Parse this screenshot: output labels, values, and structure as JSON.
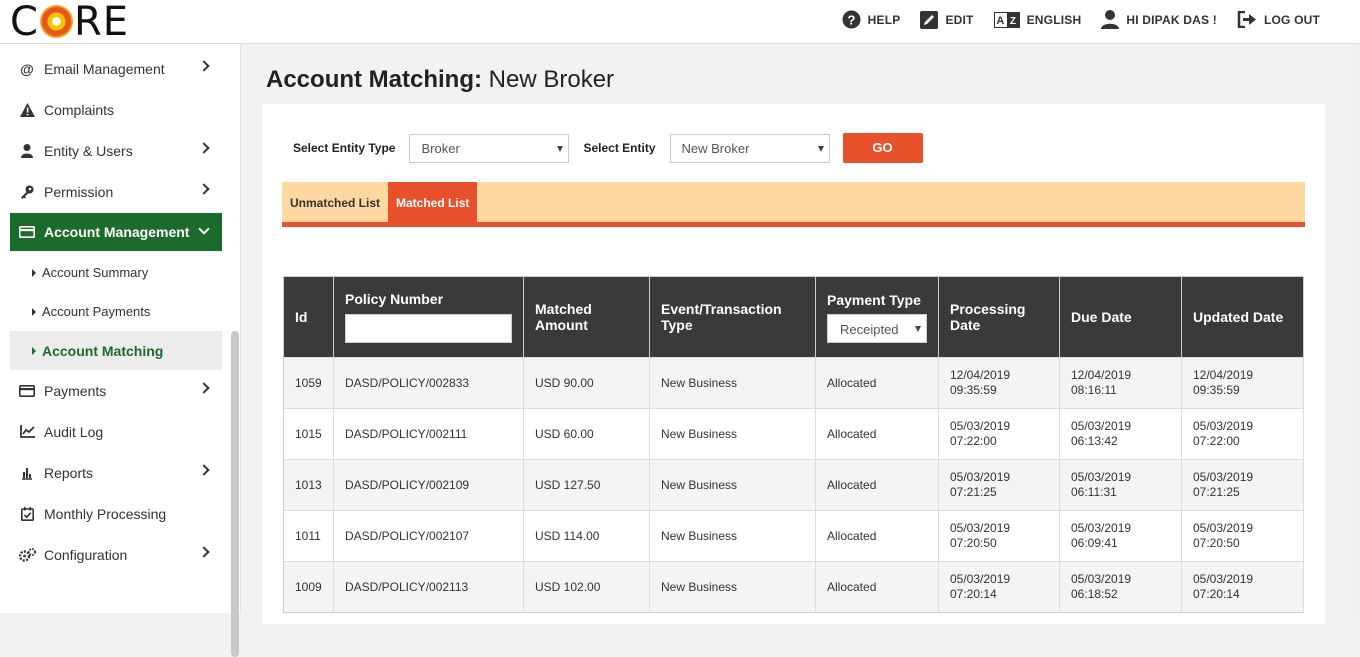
{
  "app": {
    "logo_text_left": "C",
    "logo_text_right": "RE"
  },
  "topnav": {
    "help": "HELP",
    "edit": "EDIT",
    "language": "ENGLISH",
    "user": "HI DIPAK DAS !",
    "logout": "LOG OUT"
  },
  "sidebar": {
    "items": [
      {
        "label": "Email Management",
        "icon": "at-icon",
        "chevron": true
      },
      {
        "label": "Complaints",
        "icon": "warning-icon",
        "chevron": false
      },
      {
        "label": "Entity & Users",
        "icon": "user-icon",
        "chevron": true
      },
      {
        "label": "Permission",
        "icon": "key-icon",
        "chevron": true
      },
      {
        "label": "Account Management",
        "icon": "card-icon",
        "chevron": true,
        "active": true
      },
      {
        "label": "Payments",
        "icon": "card-icon",
        "chevron": true
      },
      {
        "label": "Audit Log",
        "icon": "chart-icon",
        "chevron": false
      },
      {
        "label": "Reports",
        "icon": "reports-icon",
        "chevron": true
      },
      {
        "label": "Monthly Processing",
        "icon": "calendar-check-icon",
        "chevron": false
      },
      {
        "label": "Configuration",
        "icon": "gears-icon",
        "chevron": true
      }
    ],
    "subitems": [
      {
        "label": "Account Summary"
      },
      {
        "label": "Account Payments"
      },
      {
        "label": "Account Matching",
        "active": true
      }
    ]
  },
  "page": {
    "title_bold": "Account Matching:",
    "title_rest": "New Broker"
  },
  "filters": {
    "entity_type_label": "Select Entity Type",
    "entity_type_value": "Broker",
    "entity_label": "Select Entity",
    "entity_value": "New Broker",
    "go_label": "GO"
  },
  "tabs": [
    {
      "label": "Unmatched List",
      "active": false
    },
    {
      "label": "Matched List",
      "active": true
    }
  ],
  "table": {
    "headers": {
      "id": "Id",
      "policy": "Policy Number",
      "matched": "Matched Amount",
      "event": "Event/Transaction Type",
      "payment": "Payment Type",
      "processing": "Processing Date",
      "due": "Due Date",
      "updated": "Updated Date"
    },
    "payment_filter_value": "Receipted",
    "rows": [
      {
        "id": "1059",
        "policy": "DASD/POLICY/002833",
        "amount": "USD 90.00",
        "event": "New Business",
        "payment": "Allocated",
        "proc_date": "12/04/2019",
        "proc_time": "09:35:59",
        "due_date": "12/04/2019",
        "due_time": "08:16:11",
        "upd_date": "12/04/2019",
        "upd_time": "09:35:59"
      },
      {
        "id": "1015",
        "policy": "DASD/POLICY/002111",
        "amount": "USD 60.00",
        "event": "New Business",
        "payment": "Allocated",
        "proc_date": "05/03/2019",
        "proc_time": "07:22:00",
        "due_date": "05/03/2019",
        "due_time": "06:13:42",
        "upd_date": "05/03/2019",
        "upd_time": "07:22:00"
      },
      {
        "id": "1013",
        "policy": "DASD/POLICY/002109",
        "amount": "USD 127.50",
        "event": "New Business",
        "payment": "Allocated",
        "proc_date": "05/03/2019",
        "proc_time": "07:21:25",
        "due_date": "05/03/2019",
        "due_time": "06:11:31",
        "upd_date": "05/03/2019",
        "upd_time": "07:21:25"
      },
      {
        "id": "1011",
        "policy": "DASD/POLICY/002107",
        "amount": "USD 114.00",
        "event": "New Business",
        "payment": "Allocated",
        "proc_date": "05/03/2019",
        "proc_time": "07:20:50",
        "due_date": "05/03/2019",
        "due_time": "06:09:41",
        "upd_date": "05/03/2019",
        "upd_time": "07:20:50"
      },
      {
        "id": "1009",
        "policy": "DASD/POLICY/002113",
        "amount": "USD 102.00",
        "event": "New Business",
        "payment": "Allocated",
        "proc_date": "05/03/2019",
        "proc_time": "07:20:14",
        "due_date": "05/03/2019",
        "due_time": "06:18:52",
        "upd_date": "05/03/2019",
        "upd_time": "07:20:14"
      }
    ]
  },
  "colors": {
    "accent": "#e8512b",
    "nav_active": "#1b6b2c",
    "tab_bar": "#fed8a0",
    "header_dark": "#3a3a3a"
  }
}
